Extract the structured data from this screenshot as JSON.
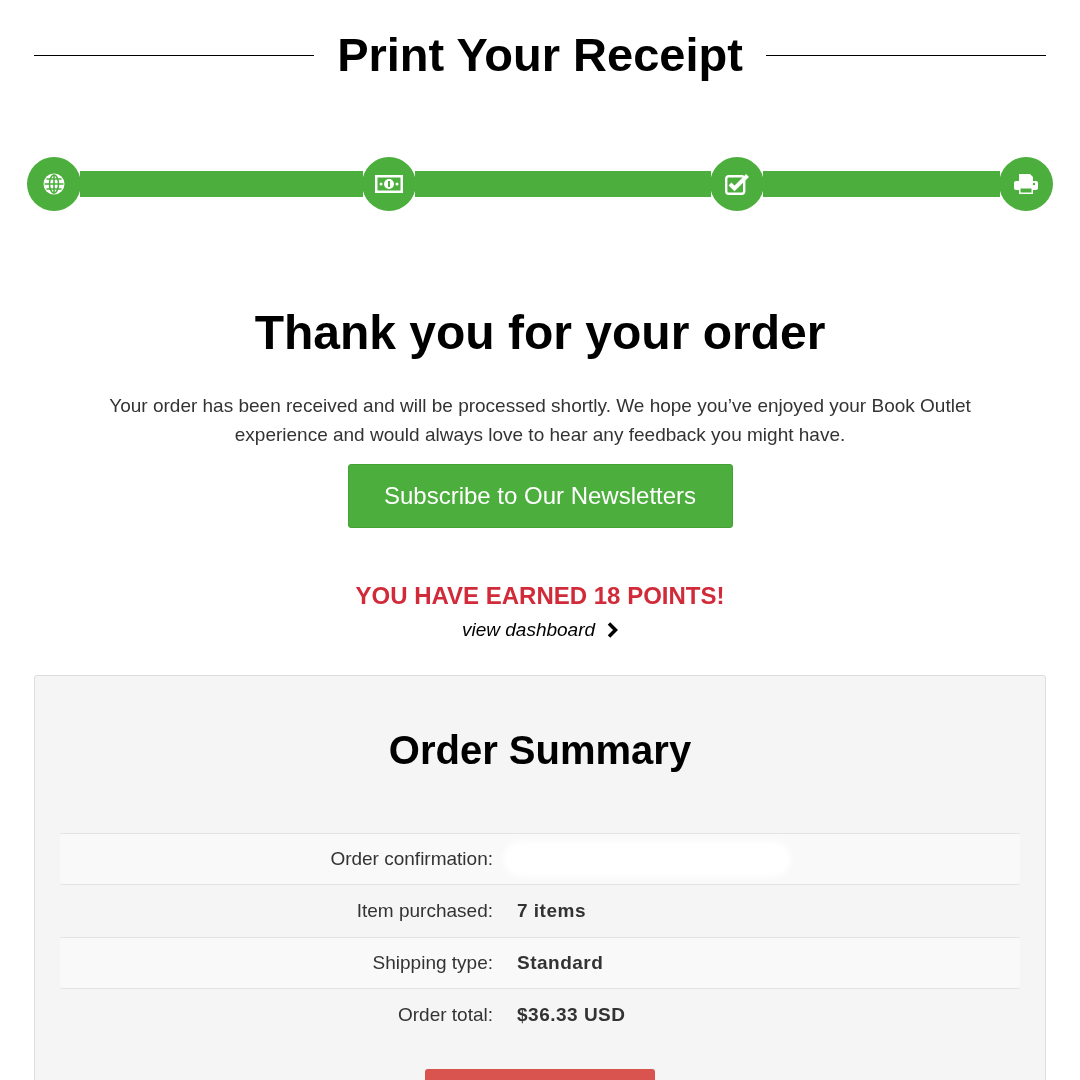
{
  "page": {
    "title": "Print Your Receipt"
  },
  "progress_steps": [
    {
      "kind": "globe"
    },
    {
      "kind": "money"
    },
    {
      "kind": "checkbox"
    },
    {
      "kind": "printer"
    }
  ],
  "confirmation": {
    "heading": "Thank you for your order",
    "message": "Your order has been received and will be processed shortly. We hope you’ve enjoyed your Book Outlet experience and would always love to hear any feedback you might have.",
    "subscribe_button": "Subscribe to Our Newsletters",
    "points_notice": "YOU HAVE EARNED 18 POINTS!",
    "dashboard_link": "view dashboard"
  },
  "order_summary": {
    "title": "Order Summary",
    "rows": [
      {
        "label": "Order confirmation:",
        "kind": "redacted"
      },
      {
        "label": "Item purchased:",
        "kind": "text",
        "value": "7 items"
      },
      {
        "label": "Shipping type:",
        "kind": "text",
        "value": "Standard"
      },
      {
        "label": "Order total:",
        "kind": "text",
        "value": "$36.33 USD"
      }
    ]
  }
}
